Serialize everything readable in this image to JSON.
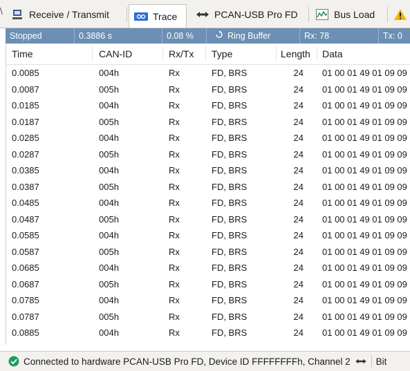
{
  "tabs": [
    {
      "label": "Receive / Transmit",
      "icon": "receive-transmit-icon"
    },
    {
      "label": "Trace",
      "icon": "trace-icon"
    },
    {
      "label": "PCAN-USB Pro FD",
      "icon": "usb-connection-icon"
    },
    {
      "label": "Bus Load",
      "icon": "bus-load-icon"
    }
  ],
  "status_strip": {
    "state": "Stopped",
    "elapsed": "0.3886 s",
    "buffer_usage": "0.08 %",
    "buffer_mode": "Ring Buffer",
    "rx": "Rx: 78",
    "tx": "Tx: 0"
  },
  "columns": [
    "Time",
    "CAN-ID",
    "Rx/Tx",
    "Type",
    "Length",
    "Data"
  ],
  "rows": [
    {
      "time": "0.0085",
      "id": "004h",
      "dir": "Rx",
      "type": "FD, BRS",
      "len": "24",
      "data": "01 00 01 49 01 09 09"
    },
    {
      "time": "0.0087",
      "id": "005h",
      "dir": "Rx",
      "type": "FD, BRS",
      "len": "24",
      "data": "01 00 01 49 01 09 09"
    },
    {
      "time": "0.0185",
      "id": "004h",
      "dir": "Rx",
      "type": "FD, BRS",
      "len": "24",
      "data": "01 00 01 49 01 09 09"
    },
    {
      "time": "0.0187",
      "id": "005h",
      "dir": "Rx",
      "type": "FD, BRS",
      "len": "24",
      "data": "01 00 01 49 01 09 09"
    },
    {
      "time": "0.0285",
      "id": "004h",
      "dir": "Rx",
      "type": "FD, BRS",
      "len": "24",
      "data": "01 00 01 49 01 09 09"
    },
    {
      "time": "0.0287",
      "id": "005h",
      "dir": "Rx",
      "type": "FD, BRS",
      "len": "24",
      "data": "01 00 01 49 01 09 09"
    },
    {
      "time": "0.0385",
      "id": "004h",
      "dir": "Rx",
      "type": "FD, BRS",
      "len": "24",
      "data": "01 00 01 49 01 09 09"
    },
    {
      "time": "0.0387",
      "id": "005h",
      "dir": "Rx",
      "type": "FD, BRS",
      "len": "24",
      "data": "01 00 01 49 01 09 09"
    },
    {
      "time": "0.0485",
      "id": "004h",
      "dir": "Rx",
      "type": "FD, BRS",
      "len": "24",
      "data": "01 00 01 49 01 09 09"
    },
    {
      "time": "0.0487",
      "id": "005h",
      "dir": "Rx",
      "type": "FD, BRS",
      "len": "24",
      "data": "01 00 01 49 01 09 09"
    },
    {
      "time": "0.0585",
      "id": "004h",
      "dir": "Rx",
      "type": "FD, BRS",
      "len": "24",
      "data": "01 00 01 49 01 09 09"
    },
    {
      "time": "0.0587",
      "id": "005h",
      "dir": "Rx",
      "type": "FD, BRS",
      "len": "24",
      "data": "01 00 01 49 01 09 09"
    },
    {
      "time": "0.0685",
      "id": "004h",
      "dir": "Rx",
      "type": "FD, BRS",
      "len": "24",
      "data": "01 00 01 49 01 09 09"
    },
    {
      "time": "0.0687",
      "id": "005h",
      "dir": "Rx",
      "type": "FD, BRS",
      "len": "24",
      "data": "01 00 01 49 01 09 09"
    },
    {
      "time": "0.0785",
      "id": "004h",
      "dir": "Rx",
      "type": "FD, BRS",
      "len": "24",
      "data": "01 00 01 49 01 09 09"
    },
    {
      "time": "0.0787",
      "id": "005h",
      "dir": "Rx",
      "type": "FD, BRS",
      "len": "24",
      "data": "01 00 01 49 01 09 09"
    },
    {
      "time": "0.0885",
      "id": "004h",
      "dir": "Rx",
      "type": "FD, BRS",
      "len": "24",
      "data": "01 00 01 49 01 09 09"
    }
  ],
  "footer": {
    "connection": "Connected to hardware PCAN-USB Pro FD, Device ID FFFFFFFFh, Channel 2",
    "trailing": "Bit"
  },
  "colors": {
    "status_strip": "#6b8fb5",
    "active_tab": "#ffffff",
    "warning": "#f2b705",
    "ok": "#1e9e5a"
  }
}
